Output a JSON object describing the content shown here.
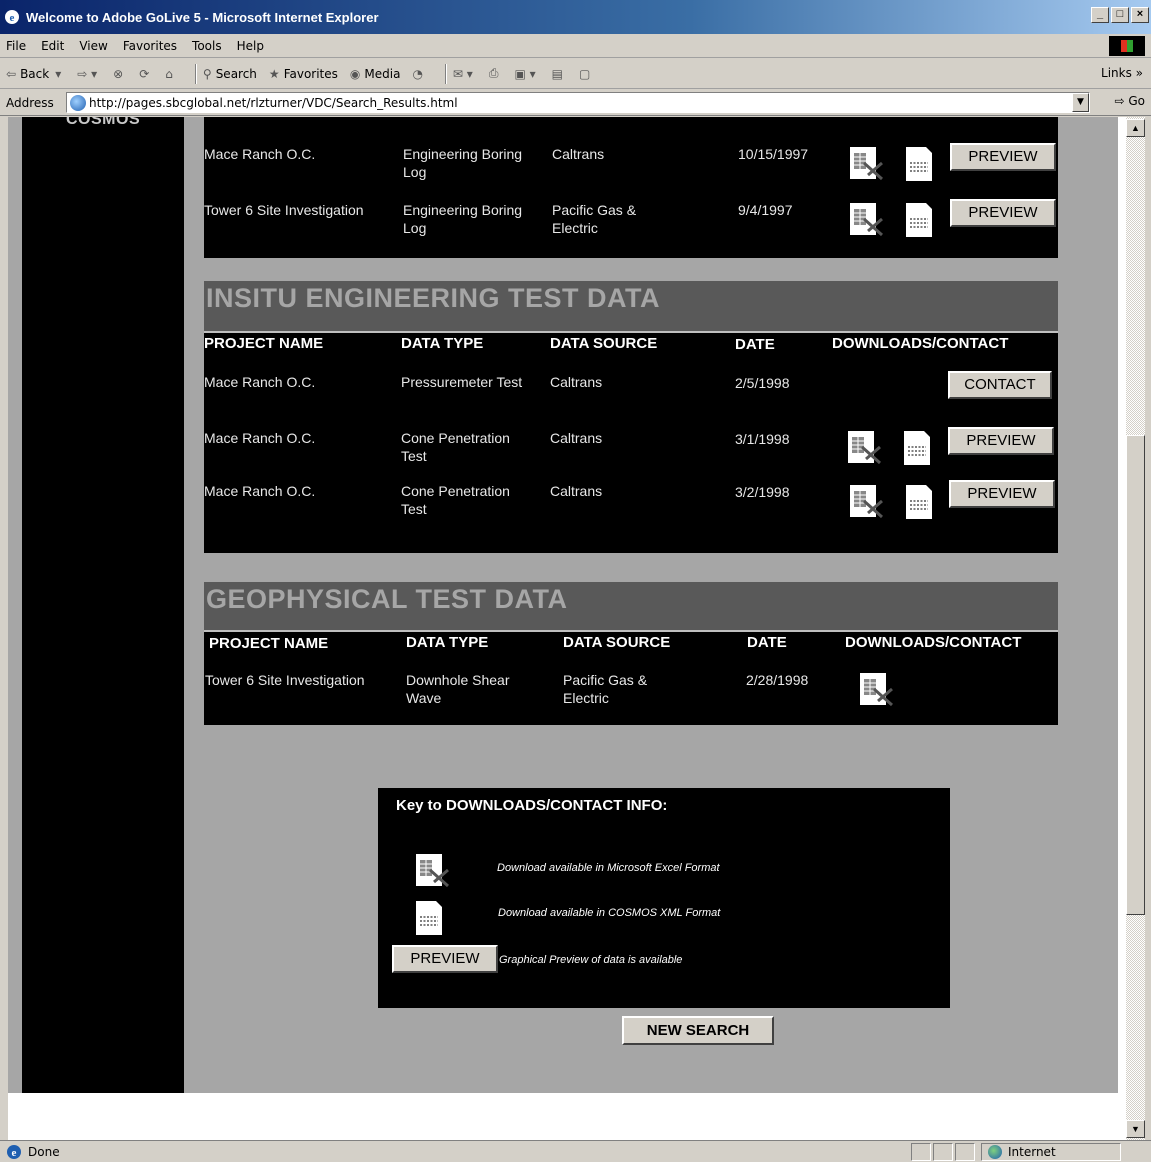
{
  "window": {
    "title": "Welcome to Adobe GoLive 5 - Microsoft Internet Explorer",
    "min": "_",
    "max": "□",
    "close": "×"
  },
  "menu": [
    "File",
    "Edit",
    "View",
    "Favorites",
    "Tools",
    "Help"
  ],
  "toolbar": {
    "back": "Back",
    "search": "Search",
    "favorites": "Favorites",
    "media": "Media",
    "links": "Links »"
  },
  "address": {
    "label": "Address",
    "url": "http://pages.sbcglobal.net/rlzturner/VDC/Search_Results.html",
    "go": "Go"
  },
  "sidebar": {
    "brand": "COSMOS"
  },
  "boring_rows": [
    {
      "project": "Mace Ranch O.C.",
      "type": "Engineering Boring Log",
      "source": "Caltrans",
      "date": "10/15/1997",
      "button": "PREVIEW"
    },
    {
      "project": "Tower 6 Site Investigation",
      "type": "Engineering Boring Log",
      "source": "Pacific Gas & Electric",
      "date": "9/4/1997",
      "button": "PREVIEW"
    }
  ],
  "insitu": {
    "title": "INSITU ENGINEERING TEST DATA",
    "headers": [
      "PROJECT NAME",
      "DATA TYPE",
      "DATA SOURCE",
      "DATE",
      "DOWNLOADS/CONTACT"
    ],
    "rows": [
      {
        "project": "Mace Ranch O.C.",
        "type": "Pressuremeter Test",
        "source": "Caltrans",
        "date": "2/5/1998",
        "button": "CONTACT"
      },
      {
        "project": "Mace Ranch O.C.",
        "type": "Cone Penetration Test",
        "source": "Caltrans",
        "date": "3/1/1998",
        "button": "PREVIEW"
      },
      {
        "project": "Mace Ranch O.C.",
        "type": "Cone Penetration Test",
        "source": "Caltrans",
        "date": "3/2/1998",
        "button": "PREVIEW"
      }
    ]
  },
  "geophysical": {
    "title": "GEOPHYSICAL TEST DATA",
    "headers": [
      "PROJECT NAME",
      "DATA TYPE",
      "DATA SOURCE",
      "DATE",
      "DOWNLOADS/CONTACT"
    ],
    "rows": [
      {
        "project": "Tower 6 Site Investigation",
        "type": "Downhole Shear Wave",
        "source": "Pacific Gas & Electric",
        "date": "2/28/1998"
      }
    ]
  },
  "key": {
    "title": "Key to DOWNLOADS/CONTACT INFO:",
    "excel": "Download available in Microsoft Excel Format",
    "xml": "Download available in COSMOS XML Format",
    "preview_button": "PREVIEW",
    "preview_text": "Graphical Preview of data is available"
  },
  "new_search": "NEW SEARCH",
  "status": {
    "left": "Done",
    "zone": "Internet"
  }
}
